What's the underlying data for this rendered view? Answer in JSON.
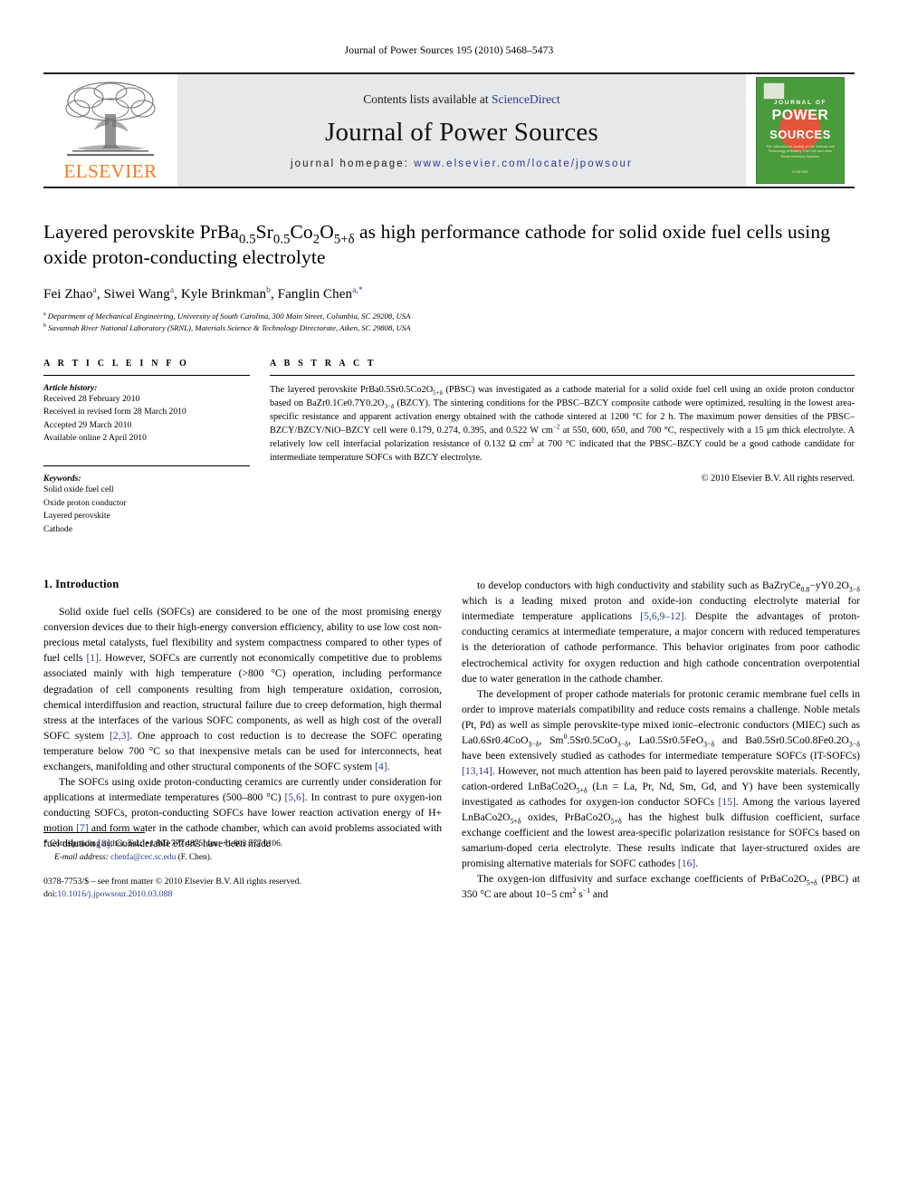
{
  "running_head": "Journal of Power Sources 195 (2010) 5468–5473",
  "masthead": {
    "contents_prefix": "Contents lists available at ",
    "sciencedirect": "ScienceDirect",
    "journal_title": "Journal of Power Sources",
    "homepage_prefix": "journal homepage:",
    "homepage_url": "www.elsevier.com/locate/jpowsour",
    "publisher_wordmark": "ELSEVIER",
    "cover": {
      "line1": "JOURNAL OF",
      "line2": "POWER",
      "line3": "SOURCES",
      "tagline": "The International Journal on the Science and Technology of Battery, Fuel Cell and other Electrochemical Systems",
      "footer": "ELSEVIER"
    },
    "colors": {
      "link_blue": "#2b3a8f",
      "elsevier_orange": "#f47a20",
      "cover_green": "#4a9b3c",
      "cover_orb": "#e2553a",
      "panel_grey": "#e7e8ea"
    }
  },
  "title_block": {
    "title_parts": [
      {
        "t": "Layered perovskite PrBa"
      },
      {
        "t": "0.5",
        "k": "sub"
      },
      {
        "t": "Sr"
      },
      {
        "t": "0.5",
        "k": "sub"
      },
      {
        "t": "Co"
      },
      {
        "t": "2",
        "k": "sub"
      },
      {
        "t": "O"
      },
      {
        "t": "5+δ",
        "k": "sub"
      },
      {
        "t": " as high performance cathode for solid oxide fuel cells using oxide proton-conducting electrolyte"
      }
    ],
    "title_plain": "Layered perovskite PrBa0.5Sr0.5Co2O5+δ as high performance cathode for solid oxide fuel cells using oxide proton-conducting electrolyte",
    "authors": [
      {
        "name": "Fei Zhao",
        "mark": "a"
      },
      {
        "name": "Siwei Wang",
        "mark": "a"
      },
      {
        "name": "Kyle Brinkman",
        "mark": "b"
      },
      {
        "name": "Fanglin Chen",
        "mark": "a,*"
      }
    ],
    "affiliations": [
      {
        "mark": "a",
        "text": "Department of Mechanical Engineering, University of South Carolina, 300 Main Street, Columbia, SC 29208, USA"
      },
      {
        "mark": "b",
        "text": "Savannah River National Laboratory (SRNL), Materials Science & Technology Directorate, Aiken, SC 29808, USA"
      }
    ]
  },
  "article_info": {
    "heading": "A R T I C L E   I N F O",
    "history_label": "Article history:",
    "history": [
      "Received 28 February 2010",
      "Received in revised form 28 March 2010",
      "Accepted 29 March 2010",
      "Available online 2 April 2010"
    ],
    "keywords_label": "Keywords:",
    "keywords": [
      "Solid oxide fuel cell",
      "Oxide proton conductor",
      "Layered perovskite",
      "Cathode"
    ]
  },
  "abstract": {
    "heading": "A B S T R A C T",
    "text": "The layered perovskite PrBa0.5Sr0.5Co2O5+δ (PBSC) was investigated as a cathode material for a solid oxide fuel cell using an oxide proton conductor based on BaZr0.1Ce0.7Y0.2O3−δ (BZCY). The sintering conditions for the PBSC–BZCY composite cathode were optimized, resulting in the lowest area-specific resistance and apparent activation energy obtained with the cathode sintered at 1200 °C for 2 h. The maximum power densities of the PBSC–BZCY/BZCY/NiO–BZCY cell were 0.179, 0.274, 0.395, and 0.522 W cm−2 at 550, 600, 650, and 700 °C, respectively with a 15 μm thick electrolyte. A relatively low cell interfacial polarization resistance of 0.132 Ω cm2 at 700 °C indicated that the PBSC–BZCY could be a good cathode candidate for intermediate temperature SOFCs with BZCY electrolyte.",
    "copyright": "© 2010 Elsevier B.V. All rights reserved."
  },
  "body": {
    "section_heading": "1.  Introduction",
    "left_paragraphs": [
      "Solid oxide fuel cells (SOFCs) are considered to be one of the most promising energy conversion devices due to their high-energy conversion efficiency, ability to use low cost non-precious metal catalysts, fuel flexibility and system compactness compared to other types of fuel cells [1]. However, SOFCs are currently not economically competitive due to problems associated mainly with high temperature (>800 °C) operation, including performance degradation of cell components resulting from high temperature oxidation, corrosion, chemical interdiffusion and reaction, structural failure due to creep deformation, high thermal stress at the interfaces of the various SOFC components, as well as high cost of the overall SOFC system [2,3]. One approach to cost reduction is to decrease the SOFC operating temperature below 700 °C so that inexpensive metals can be used for interconnects, heat exchangers, manifolding and other structural components of the SOFC system [4].",
      "The SOFCs using oxide proton-conducting ceramics are currently under consideration for applications at intermediate temperatures (500–800 °C) [5,6]. In contrast to pure oxygen-ion conducting SOFCs, proton-conducting SOFCs have lower reaction activation energy of H+ motion [7] and form water in the cathode chamber, which can avoid problems associated with fuel dilution [8]. Considerable efforts have been made"
    ],
    "right_paragraphs": [
      "to develop conductors with high conductivity and stability such as BaZryCe0.8−yY0.2O3−δ which is a leading mixed proton and oxide-ion conducting electrolyte material for intermediate temperature applications [5,6,9–12]. Despite the advantages of proton-conducting ceramics at intermediate temperature, a major concern with reduced temperatures is the deterioration of cathode performance. This behavior originates from poor cathodic electrochemical activity for oxygen reduction and high cathode concentration overpotential due to water generation in the cathode chamber.",
      "The development of proper cathode materials for protonic ceramic membrane fuel cells in order to improve materials compatibility and reduce costs remains a challenge. Noble metals (Pt, Pd) as well as simple perovskite-type mixed ionic–electronic conductors (MIEC) such as La0.6Sr0.4CoO3−δ, Sm0.5Sr0.5CoO3−δ, La0.5Sr0.5FeO3−δ and Ba0.5Sr0.5Co0.8Fe0.2O3−δ have been extensively studied as cathodes for intermediate temperature SOFCs (IT-SOFCs) [13,14]. However, not much attention has been paid to layered perovskite materials. Recently, cation-ordered LnBaCo2O5+δ (Ln = La, Pr, Nd, Sm, Gd, and Y) have been systemically investigated as cathodes for oxygen-ion conductor SOFCs [15]. Among the various layered LnBaCo2O5+δ oxides, PrBaCo2O5+δ has the highest bulk diffusion coefficient, surface exchange coefficient and the lowest area-specific polarization resistance for SOFCs based on samarium-doped ceria electrolyte. These results indicate that layer-structured oxides are promising alternative materials for SOFC cathodes [16].",
      "The oxygen-ion diffusivity and surface exchange coefficients of PrBaCo2O5+δ (PBC) at 350 °C are about 10−5 cm2 s−1 and"
    ]
  },
  "footnote": {
    "corresponding": "* Corresponding author. Tel.: +1 803 777 4875; fax: +1 803 777 0106.",
    "email_label": "E-mail address:",
    "email": "chenfa@cec.sc.edu",
    "email_suffix": "(F. Chen).",
    "issn_line": "0378-7753/$ – see front matter © 2010 Elsevier B.V. All rights reserved.",
    "doi_prefix": "doi:",
    "doi": "10.1016/j.jpowsour.2010.03.088"
  }
}
